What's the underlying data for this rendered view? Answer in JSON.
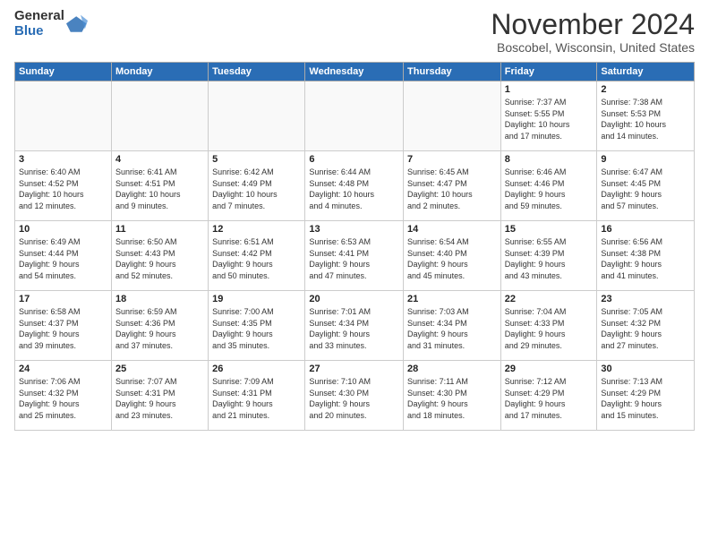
{
  "logo": {
    "general": "General",
    "blue": "Blue"
  },
  "header": {
    "month": "November 2024",
    "location": "Boscobel, Wisconsin, United States"
  },
  "weekdays": [
    "Sunday",
    "Monday",
    "Tuesday",
    "Wednesday",
    "Thursday",
    "Friday",
    "Saturday"
  ],
  "weeks": [
    [
      {
        "day": "",
        "info": ""
      },
      {
        "day": "",
        "info": ""
      },
      {
        "day": "",
        "info": ""
      },
      {
        "day": "",
        "info": ""
      },
      {
        "day": "",
        "info": ""
      },
      {
        "day": "1",
        "info": "Sunrise: 7:37 AM\nSunset: 5:55 PM\nDaylight: 10 hours\nand 17 minutes."
      },
      {
        "day": "2",
        "info": "Sunrise: 7:38 AM\nSunset: 5:53 PM\nDaylight: 10 hours\nand 14 minutes."
      }
    ],
    [
      {
        "day": "3",
        "info": "Sunrise: 6:40 AM\nSunset: 4:52 PM\nDaylight: 10 hours\nand 12 minutes."
      },
      {
        "day": "4",
        "info": "Sunrise: 6:41 AM\nSunset: 4:51 PM\nDaylight: 10 hours\nand 9 minutes."
      },
      {
        "day": "5",
        "info": "Sunrise: 6:42 AM\nSunset: 4:49 PM\nDaylight: 10 hours\nand 7 minutes."
      },
      {
        "day": "6",
        "info": "Sunrise: 6:44 AM\nSunset: 4:48 PM\nDaylight: 10 hours\nand 4 minutes."
      },
      {
        "day": "7",
        "info": "Sunrise: 6:45 AM\nSunset: 4:47 PM\nDaylight: 10 hours\nand 2 minutes."
      },
      {
        "day": "8",
        "info": "Sunrise: 6:46 AM\nSunset: 4:46 PM\nDaylight: 9 hours\nand 59 minutes."
      },
      {
        "day": "9",
        "info": "Sunrise: 6:47 AM\nSunset: 4:45 PM\nDaylight: 9 hours\nand 57 minutes."
      }
    ],
    [
      {
        "day": "10",
        "info": "Sunrise: 6:49 AM\nSunset: 4:44 PM\nDaylight: 9 hours\nand 54 minutes."
      },
      {
        "day": "11",
        "info": "Sunrise: 6:50 AM\nSunset: 4:43 PM\nDaylight: 9 hours\nand 52 minutes."
      },
      {
        "day": "12",
        "info": "Sunrise: 6:51 AM\nSunset: 4:42 PM\nDaylight: 9 hours\nand 50 minutes."
      },
      {
        "day": "13",
        "info": "Sunrise: 6:53 AM\nSunset: 4:41 PM\nDaylight: 9 hours\nand 47 minutes."
      },
      {
        "day": "14",
        "info": "Sunrise: 6:54 AM\nSunset: 4:40 PM\nDaylight: 9 hours\nand 45 minutes."
      },
      {
        "day": "15",
        "info": "Sunrise: 6:55 AM\nSunset: 4:39 PM\nDaylight: 9 hours\nand 43 minutes."
      },
      {
        "day": "16",
        "info": "Sunrise: 6:56 AM\nSunset: 4:38 PM\nDaylight: 9 hours\nand 41 minutes."
      }
    ],
    [
      {
        "day": "17",
        "info": "Sunrise: 6:58 AM\nSunset: 4:37 PM\nDaylight: 9 hours\nand 39 minutes."
      },
      {
        "day": "18",
        "info": "Sunrise: 6:59 AM\nSunset: 4:36 PM\nDaylight: 9 hours\nand 37 minutes."
      },
      {
        "day": "19",
        "info": "Sunrise: 7:00 AM\nSunset: 4:35 PM\nDaylight: 9 hours\nand 35 minutes."
      },
      {
        "day": "20",
        "info": "Sunrise: 7:01 AM\nSunset: 4:34 PM\nDaylight: 9 hours\nand 33 minutes."
      },
      {
        "day": "21",
        "info": "Sunrise: 7:03 AM\nSunset: 4:34 PM\nDaylight: 9 hours\nand 31 minutes."
      },
      {
        "day": "22",
        "info": "Sunrise: 7:04 AM\nSunset: 4:33 PM\nDaylight: 9 hours\nand 29 minutes."
      },
      {
        "day": "23",
        "info": "Sunrise: 7:05 AM\nSunset: 4:32 PM\nDaylight: 9 hours\nand 27 minutes."
      }
    ],
    [
      {
        "day": "24",
        "info": "Sunrise: 7:06 AM\nSunset: 4:32 PM\nDaylight: 9 hours\nand 25 minutes."
      },
      {
        "day": "25",
        "info": "Sunrise: 7:07 AM\nSunset: 4:31 PM\nDaylight: 9 hours\nand 23 minutes."
      },
      {
        "day": "26",
        "info": "Sunrise: 7:09 AM\nSunset: 4:31 PM\nDaylight: 9 hours\nand 21 minutes."
      },
      {
        "day": "27",
        "info": "Sunrise: 7:10 AM\nSunset: 4:30 PM\nDaylight: 9 hours\nand 20 minutes."
      },
      {
        "day": "28",
        "info": "Sunrise: 7:11 AM\nSunset: 4:30 PM\nDaylight: 9 hours\nand 18 minutes."
      },
      {
        "day": "29",
        "info": "Sunrise: 7:12 AM\nSunset: 4:29 PM\nDaylight: 9 hours\nand 17 minutes."
      },
      {
        "day": "30",
        "info": "Sunrise: 7:13 AM\nSunset: 4:29 PM\nDaylight: 9 hours\nand 15 minutes."
      }
    ]
  ]
}
